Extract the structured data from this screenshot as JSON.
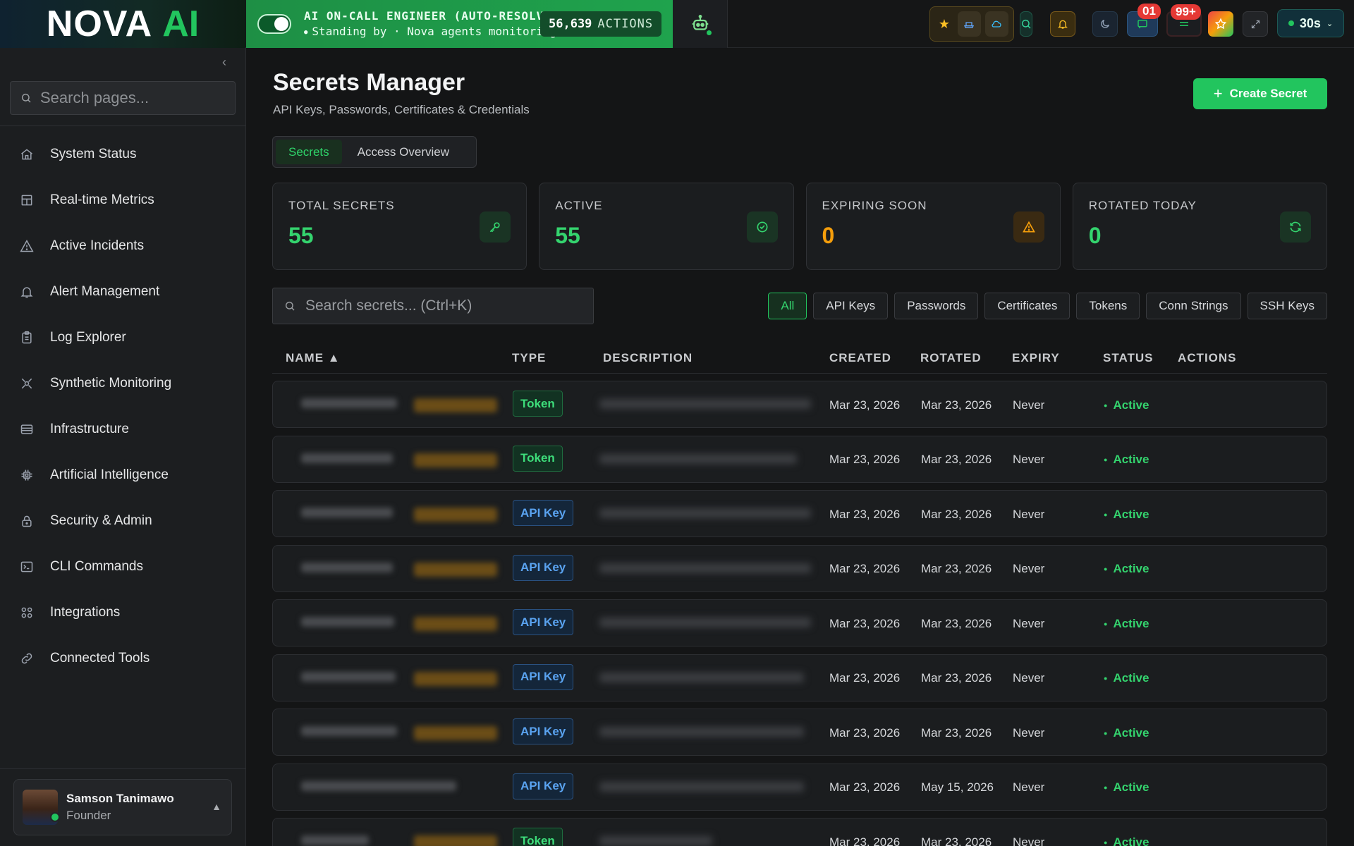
{
  "brand": {
    "part1": "NOVA",
    "part2": "AI"
  },
  "oncall": {
    "title": "AI ON-CALL ENGINEER (AUTO-RESOLVE)",
    "subtitle": "Standing by · Nova agents monitoring",
    "actions_count": "56,639",
    "actions_label": "ACTIONS"
  },
  "toolbar": {
    "badge_messages": "01",
    "badge_notifications": "99+",
    "refresh_interval": "30s"
  },
  "sidebar": {
    "search_placeholder": "Search pages...",
    "items": [
      {
        "label": "System Status",
        "icon": "home-icon"
      },
      {
        "label": "Real-time Metrics",
        "icon": "layout-icon"
      },
      {
        "label": "Active Incidents",
        "icon": "warning-icon"
      },
      {
        "label": "Alert Management",
        "icon": "bell-icon"
      },
      {
        "label": "Log Explorer",
        "icon": "clipboard-icon"
      },
      {
        "label": "Synthetic Monitoring",
        "icon": "radar-icon"
      },
      {
        "label": "Infrastructure",
        "icon": "server-icon"
      },
      {
        "label": "Artificial Intelligence",
        "icon": "chip-icon"
      },
      {
        "label": "Security & Admin",
        "icon": "lock-icon"
      },
      {
        "label": "CLI Commands",
        "icon": "terminal-icon"
      },
      {
        "label": "Integrations",
        "icon": "grid-icon"
      },
      {
        "label": "Connected Tools",
        "icon": "link-icon"
      }
    ],
    "user": {
      "name": "Samson Tanimawo",
      "role": "Founder"
    }
  },
  "page": {
    "title": "Secrets Manager",
    "subtitle": "API Keys, Passwords, Certificates & Credentials",
    "create_label": "Create Secret",
    "tabs": [
      "Secrets",
      "Access Overview"
    ],
    "stats": [
      {
        "label": "TOTAL SECRETS",
        "value": "55",
        "color": "#34d46e"
      },
      {
        "label": "ACTIVE",
        "value": "55",
        "color": "#34d46e"
      },
      {
        "label": "EXPIRING SOON",
        "value": "0",
        "color": "#f59e0b"
      },
      {
        "label": "ROTATED TODAY",
        "value": "0",
        "color": "#34d46e"
      }
    ],
    "search_placeholder": "Search secrets... (Ctrl+K)",
    "filters": [
      "All",
      "API Keys",
      "Passwords",
      "Certificates",
      "Tokens",
      "Conn Strings",
      "SSH Keys"
    ],
    "columns": {
      "name": "NAME ▲",
      "type": "TYPE",
      "description": "DESCRIPTION",
      "created": "CREATED",
      "rotated": "ROTATED",
      "expiry": "EXPIRY",
      "status": "STATUS",
      "actions": "ACTIONS"
    },
    "rows": [
      {
        "type": "Token",
        "created": "Mar 23, 2026",
        "rotated": "Mar 23, 2026",
        "expiry": "Never",
        "status": "Active"
      },
      {
        "type": "Token",
        "created": "Mar 23, 2026",
        "rotated": "Mar 23, 2026",
        "expiry": "Never",
        "status": "Active"
      },
      {
        "type": "API Key",
        "created": "Mar 23, 2026",
        "rotated": "Mar 23, 2026",
        "expiry": "Never",
        "status": "Active"
      },
      {
        "type": "API Key",
        "created": "Mar 23, 2026",
        "rotated": "Mar 23, 2026",
        "expiry": "Never",
        "status": "Active"
      },
      {
        "type": "API Key",
        "created": "Mar 23, 2026",
        "rotated": "Mar 23, 2026",
        "expiry": "Never",
        "status": "Active"
      },
      {
        "type": "API Key",
        "created": "Mar 23, 2026",
        "rotated": "Mar 23, 2026",
        "expiry": "Never",
        "status": "Active"
      },
      {
        "type": "API Key",
        "created": "Mar 23, 2026",
        "rotated": "Mar 23, 2026",
        "expiry": "Never",
        "status": "Active"
      },
      {
        "type": "API Key",
        "created": "Mar 23, 2026",
        "rotated": "May 15, 2026",
        "expiry": "Never",
        "status": "Active"
      },
      {
        "type": "Token",
        "created": "Mar 23, 2026",
        "rotated": "Mar 23, 2026",
        "expiry": "Never",
        "status": "Active"
      }
    ]
  }
}
